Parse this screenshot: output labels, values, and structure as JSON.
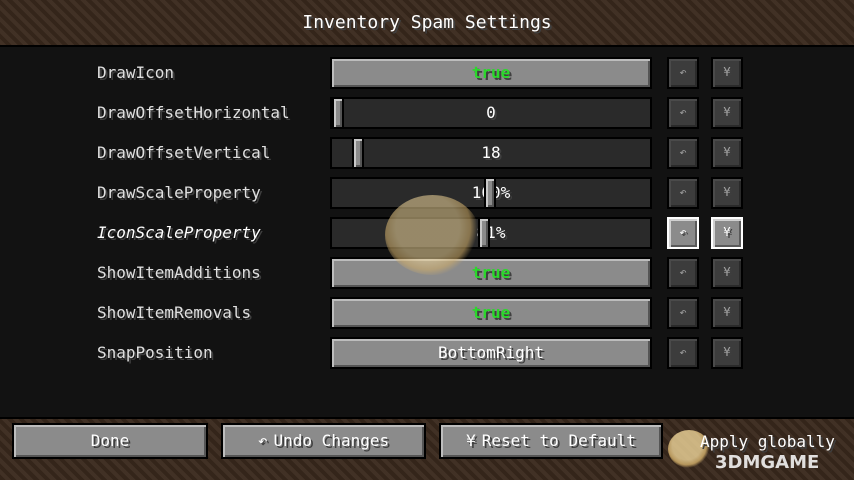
{
  "screen": {
    "title": "Inventory Spam Settings"
  },
  "settings": [
    {
      "label": "DrawIcon",
      "type": "toggle",
      "value": "true"
    },
    {
      "label": "DrawOffsetHorizontal",
      "type": "slider",
      "value": "0",
      "position": 0.0
    },
    {
      "label": "DrawOffsetVertical",
      "type": "slider",
      "value": "18",
      "position": 0.07
    },
    {
      "label": "DrawScaleProperty",
      "type": "slider",
      "value": "100%",
      "position": 0.48
    },
    {
      "label": "IconScaleProperty",
      "type": "slider",
      "value": "81%",
      "position": 0.46
    },
    {
      "label": "ShowItemAdditions",
      "type": "toggle",
      "value": "true"
    },
    {
      "label": "ShowItemRemovals",
      "type": "toggle",
      "value": "true"
    },
    {
      "label": "SnapPosition",
      "type": "select",
      "value": "BottomRight"
    }
  ],
  "row_actions": {
    "undo_icon": "undo-arrow-icon",
    "reset_icon": "reset-icon",
    "undo_glyph": "↶",
    "reset_glyph": "¥"
  },
  "footer": {
    "done": "Done",
    "undo": "Undo Changes",
    "undo_glyph": "↶",
    "reset": "Reset to Default",
    "reset_glyph": "¥",
    "apply_globally": "Apply globally"
  },
  "watermark": "3DMGAME",
  "colors": {
    "true_value": "#2bd82b",
    "button": "#8b8b8b",
    "panel": "#121212"
  }
}
